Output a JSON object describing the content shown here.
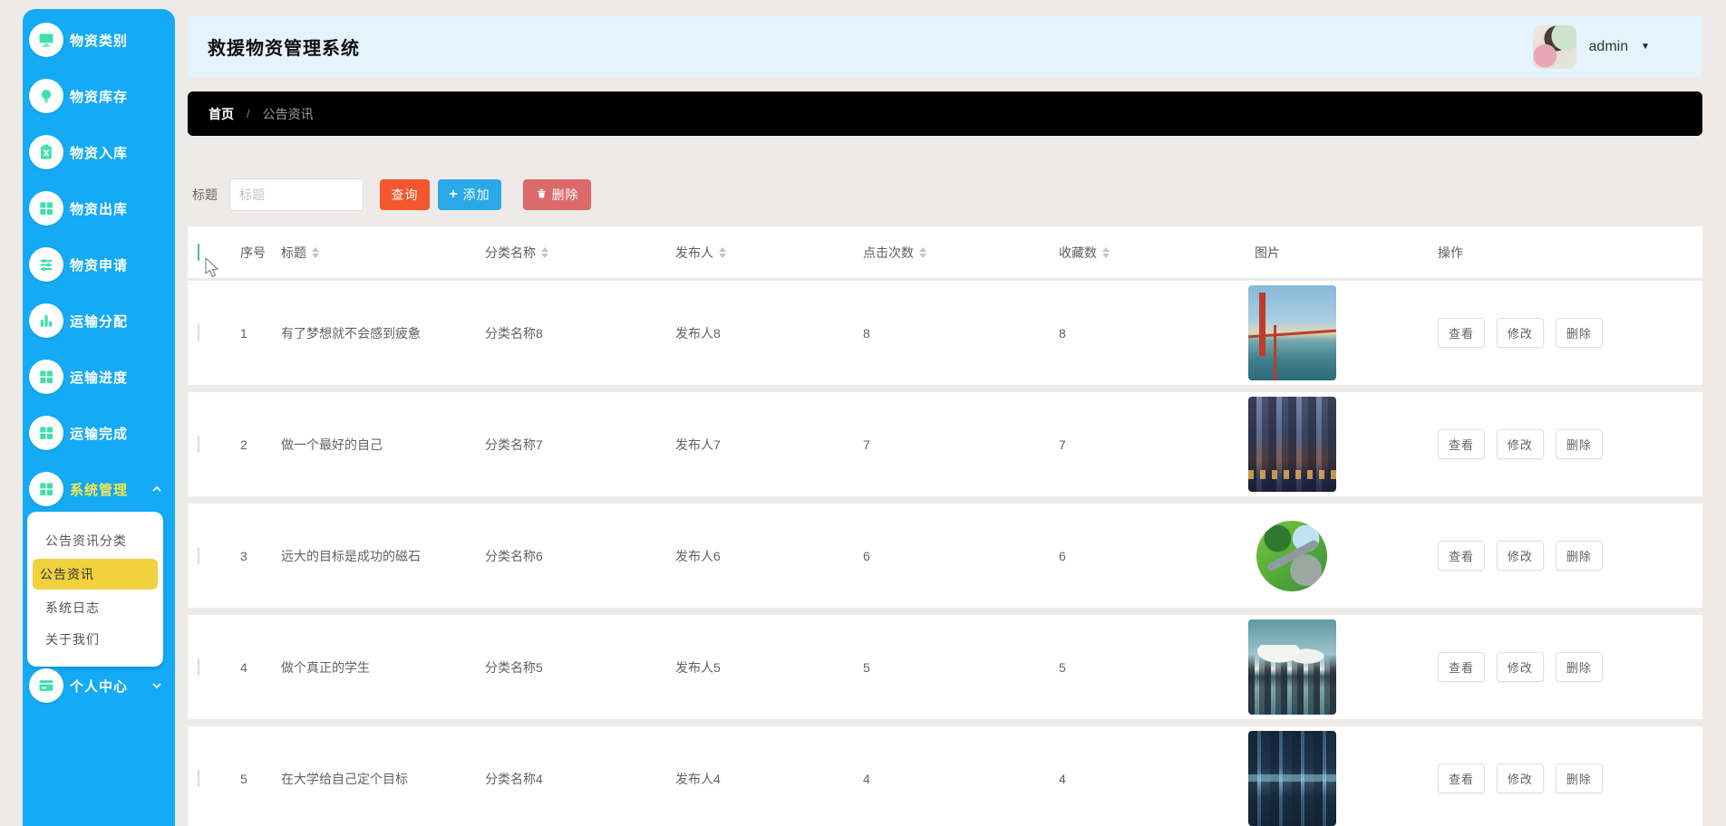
{
  "app": {
    "title": "救援物资管理系统",
    "user": {
      "name": "admin"
    }
  },
  "colors": {
    "sidebar_blue": "#14aaf5",
    "icon_teal": "#3fe0ac",
    "active_menu_yellow": "#f7e84b",
    "submenu_active_bg": "#f2d13f",
    "header_bg": "#e4f3fc",
    "breadcrumb_bg": "#000000",
    "search_button": "#f4572e",
    "add_button": "#29a9e8",
    "delete_button": "#dd6a6a",
    "page_bg": "#edeae8"
  },
  "sidebar": {
    "items": [
      {
        "label": "物资类别",
        "icon": "monitor-icon"
      },
      {
        "label": "物资库存",
        "icon": "bulb-icon"
      },
      {
        "label": "物资入库",
        "icon": "clipboard-icon"
      },
      {
        "label": "物资出库",
        "icon": "grid-icon"
      },
      {
        "label": "物资申请",
        "icon": "sliders-icon"
      },
      {
        "label": "运输分配",
        "icon": "bar-chart-icon"
      },
      {
        "label": "运输进度",
        "icon": "grid-icon"
      },
      {
        "label": "运输完成",
        "icon": "grid-icon"
      },
      {
        "label": "系统管理",
        "icon": "grid-icon",
        "active": true,
        "expanded": true
      }
    ],
    "submenu": [
      {
        "label": "公告资讯分类",
        "active": false
      },
      {
        "label": "公告资讯",
        "active": true
      },
      {
        "label": "系统日志",
        "active": false
      },
      {
        "label": "关于我们",
        "active": false
      }
    ],
    "footer_item": {
      "label": "个人中心",
      "icon": "card-icon",
      "expanded": false
    }
  },
  "breadcrumb": {
    "home": "首页",
    "separator": "/",
    "current": "公告资讯"
  },
  "toolbar": {
    "filter_label": "标题",
    "input_value": "",
    "input_placeholder": "标题",
    "search_label": "查询",
    "add_label": "添加",
    "delete_label": "删除"
  },
  "table": {
    "columns": [
      "序号",
      "标题",
      "分类名称",
      "发布人",
      "点击次数",
      "收藏数",
      "图片",
      "操作"
    ],
    "actions": [
      "查看",
      "修改",
      "删除"
    ],
    "rows": [
      {
        "index": "1",
        "title": "有了梦想就不会感到疲惫",
        "category": "分类名称8",
        "publisher": "发布人8",
        "clicks": "8",
        "favorites": "8",
        "image": "bridge-photo"
      },
      {
        "index": "2",
        "title": "做一个最好的自己",
        "category": "分类名称7",
        "publisher": "发布人7",
        "clicks": "7",
        "favorites": "7",
        "image": "city-dusk-photo"
      },
      {
        "index": "3",
        "title": "远大的目标是成功的磁石",
        "category": "分类名称6",
        "publisher": "发布人6",
        "clicks": "6",
        "favorites": "6",
        "image": "eco-globe-photo"
      },
      {
        "index": "4",
        "title": "做个真正的学生",
        "category": "分类名称5",
        "publisher": "发布人5",
        "clicks": "5",
        "favorites": "5",
        "image": "sea-city-photo"
      },
      {
        "index": "5",
        "title": "在大学给自己定个目标",
        "category": "分类名称4",
        "publisher": "发布人4",
        "clicks": "4",
        "favorites": "4",
        "image": "future-city-photo"
      }
    ]
  }
}
